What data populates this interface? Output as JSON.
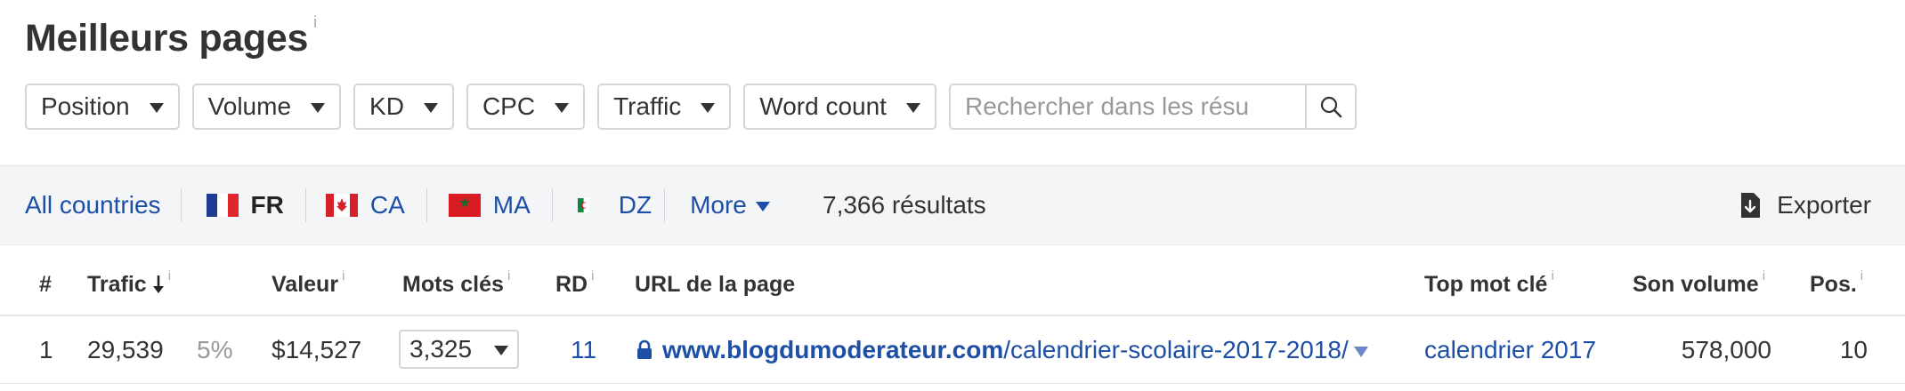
{
  "title": "Meilleurs pages",
  "info_marker": "i",
  "filters": [
    "Position",
    "Volume",
    "KD",
    "CPC",
    "Traffic",
    "Word count"
  ],
  "search": {
    "placeholder": "Rechercher dans les résu"
  },
  "countries": {
    "all": "All countries",
    "items": [
      {
        "code": "FR",
        "flag": "france-flag"
      },
      {
        "code": "CA",
        "flag": "canada-flag"
      },
      {
        "code": "MA",
        "flag": "morocco-flag"
      },
      {
        "code": "DZ",
        "flag": "algeria-flag"
      }
    ],
    "more": "More",
    "results": "7,366 résultats",
    "export": "Exporter"
  },
  "table": {
    "columns": {
      "index": "#",
      "traffic": "Trafic",
      "value": "Valeur",
      "keywords": "Mots clés",
      "rd": "RD",
      "url": "URL de la page",
      "top_keyword": "Top mot clé",
      "volume": "Son volume",
      "position": "Pos."
    },
    "rows": [
      {
        "index": "1",
        "traffic": "29,539",
        "traffic_share": "5%",
        "value": "$14,527",
        "keywords": "3,325",
        "rd": "11",
        "url_host": "www.blogdumoderateur.com",
        "url_path": "/calendrier-scolaire-2017-2018/",
        "top_keyword": "calendrier 2017",
        "volume": "578,000",
        "position": "10"
      }
    ]
  },
  "colors": {
    "link": "#1e4fa6",
    "border": "#d5d5d5",
    "bar_bg": "#f4f5f7"
  }
}
